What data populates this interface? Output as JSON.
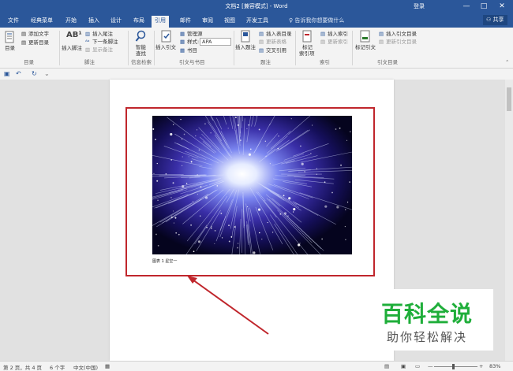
{
  "window": {
    "title": "文档2 [兼容模式] - Word",
    "login": "登录",
    "minimize_glyph": "—",
    "restore_glyph": "□",
    "close_glyph": "✕"
  },
  "tabs": [
    "文件",
    "经典菜单",
    "开始",
    "插入",
    "设计",
    "布局",
    "引用",
    "邮件",
    "审阅",
    "视图",
    "开发工具"
  ],
  "active_tab": "引用",
  "tell_me": "♀ 告诉我你想要做什么",
  "share": "共享",
  "ribbon": {
    "toc": {
      "label": "目录",
      "add_text": "添加文字",
      "update": "更新目录",
      "group": "目录"
    },
    "footnotes": {
      "insert_footnote": "插入脚注",
      "insert_endnote": "插入尾注",
      "next_footnote": "下一条脚注",
      "show_notes": "显示备注",
      "group": "脚注"
    },
    "research": {
      "smart_lookup_1": "智能",
      "smart_lookup_2": "查找",
      "group": "信息检索"
    },
    "citations": {
      "insert_citation": "插入引文",
      "manage_sources": "管理源",
      "style_label": "样式:",
      "style_value": "APA",
      "bibliography": "书目",
      "group": "引文与书目"
    },
    "captions": {
      "insert_caption": "插入题注",
      "insert_table_of_figures": "插入表目录",
      "update_table": "更新表格",
      "cross_reference": "交叉引用",
      "group": "题注"
    },
    "index": {
      "mark_entry_1": "标记",
      "mark_entry_2": "索引项",
      "insert_index": "插入索引",
      "update_index": "更新索引",
      "group": "索引"
    },
    "authorities": {
      "mark_citation": "标记引文",
      "insert_toa": "插入引文目录",
      "update_toa": "更新引文目录",
      "group": "引文目录"
    }
  },
  "qat": {
    "save_icon": "floppy-icon",
    "undo": "↶",
    "redo": "↻",
    "customize": "⌄"
  },
  "document": {
    "caption": "图表 1 星空一"
  },
  "watermark": {
    "big": "百科全说",
    "small": "助你轻松解决"
  },
  "status": {
    "page": "第 2 页，共 4 页",
    "words": "6 个字",
    "language": "中文(中国)",
    "zoom": "83%"
  },
  "colors": {
    "accent": "#2b579a",
    "annotation": "#c0262c",
    "watermark_green": "#1fae3a"
  }
}
